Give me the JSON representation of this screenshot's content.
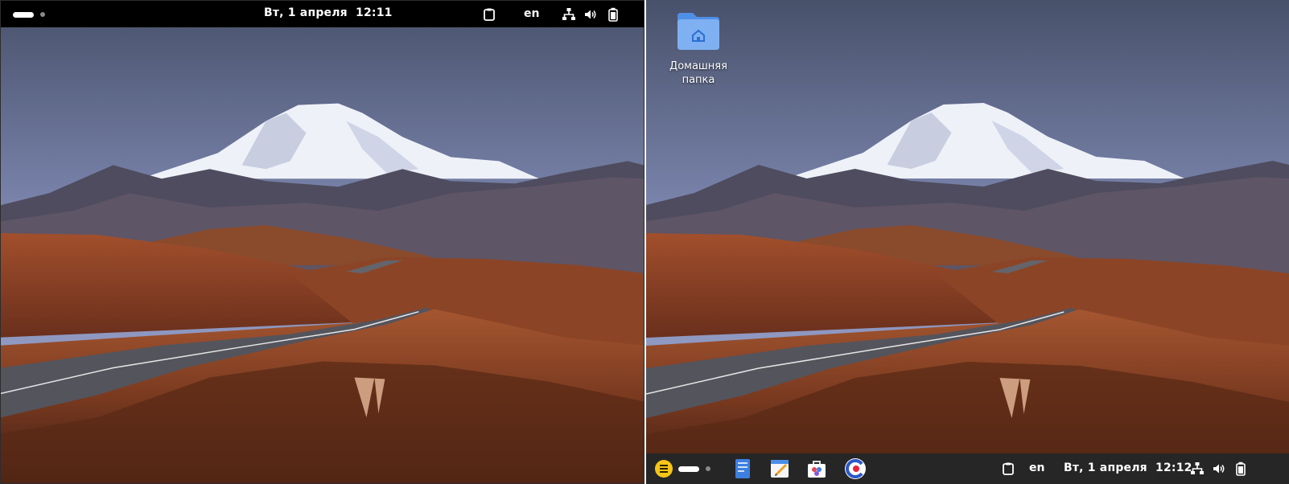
{
  "left_screen": {
    "topbar": {
      "datetime": "Вт, 1 апреля  12:11",
      "keyboard_layout": "en"
    }
  },
  "right_screen": {
    "desktop_icons": [
      {
        "label": "Домашняя папка",
        "icon": "home-folder-icon"
      }
    ],
    "bottom_panel": {
      "apps": [
        "menu-icon",
        "text-editor-icon",
        "notes-icon",
        "software-store-icon",
        "browser-icon"
      ],
      "datetime": "Вт, 1 апреля  12:12",
      "keyboard_layout": "en"
    }
  },
  "tray_icons": [
    "clipboard-icon",
    "network-icon",
    "volume-icon",
    "battery-icon"
  ],
  "colors": {
    "panel": "#000000",
    "dock": "#262626",
    "folder": "#5b9af0",
    "accent": "#f5c518"
  }
}
